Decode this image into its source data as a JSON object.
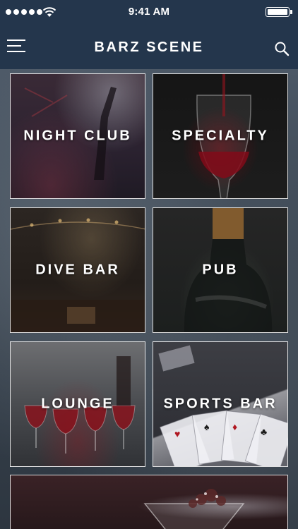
{
  "status_bar": {
    "time": "9:41 AM",
    "icons": [
      "signal-dots-icon",
      "wifi-icon",
      "battery-icon"
    ]
  },
  "nav": {
    "title": "BARZ SCENE",
    "icons": [
      "hamburger-menu-icon",
      "search-icon"
    ]
  },
  "categories": [
    {
      "label": "NIGHT CLUB"
    },
    {
      "label": "SPECIALTY"
    },
    {
      "label": "DIVE BAR"
    },
    {
      "label": "PUB"
    },
    {
      "label": "LOUNGE"
    },
    {
      "label": "SPORTS BAR"
    },
    {
      "label": ""
    }
  ],
  "colors": {
    "nav_background": "#24364c",
    "tile_border": "#ffffff",
    "text": "#ffffff"
  }
}
